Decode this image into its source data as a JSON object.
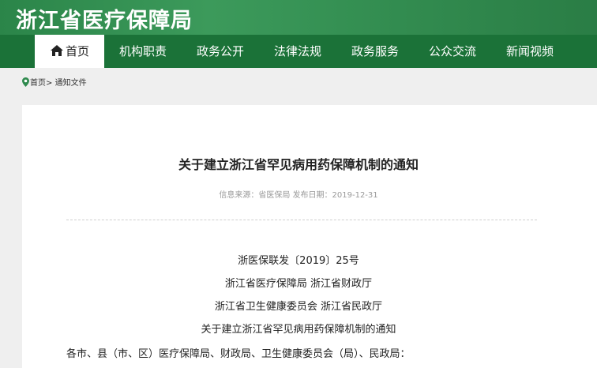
{
  "site": {
    "title": "浙江省医疗保障局"
  },
  "nav": {
    "items": [
      {
        "label": "首页",
        "active": true,
        "icon": "home-icon"
      },
      {
        "label": "机构职责"
      },
      {
        "label": "政务公开"
      },
      {
        "label": "法律法规"
      },
      {
        "label": "政务服务"
      },
      {
        "label": "公众交流"
      },
      {
        "label": "新闻视频"
      }
    ]
  },
  "breadcrumb": {
    "home": "首页",
    "separator": ">",
    "current": "通知文件",
    "icon": "location-pin-icon"
  },
  "article": {
    "title": "关于建立浙江省罕见病用药保障机制的通知",
    "meta": "信息来源：省医保局 发布日期：2019-12-31",
    "doc_number": "浙医保联发〔2019〕25号",
    "issuers_line1": "浙江省医疗保障局  浙江省财政厅",
    "issuers_line2": "浙江省卫生健康委员会  浙江省民政厅",
    "doc_title": "关于建立浙江省罕见病用药保障机制的通知",
    "addressee": "各市、县（市、区）医疗保障局、财政局、卫生健康委员会（局）、民政局："
  },
  "colors": {
    "header": "#2f8a4e",
    "nav": "#1b7238",
    "background": "#efefef"
  }
}
